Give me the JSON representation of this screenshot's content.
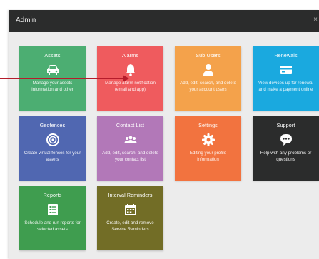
{
  "window": {
    "title": "Admin",
    "close_glyph": "×"
  },
  "tiles": [
    {
      "title": "Assets",
      "icon": "car-icon",
      "description": "Manage your assets information and other",
      "color": "#4cae72"
    },
    {
      "title": "Alarms",
      "icon": "bell-icon",
      "description": "Manage alarm notification (email and app)",
      "color": "#ef5b5e"
    },
    {
      "title": "Sub Users",
      "icon": "user-icon",
      "description": "Add, edit, search, and delete your account users",
      "color": "#f4a24b"
    },
    {
      "title": "Renewals",
      "icon": "card-icon",
      "description": "View devices up for renewal and make a payment online",
      "color": "#1aa9df"
    },
    {
      "title": "Geofences",
      "icon": "target-icon",
      "description": "Create virtual fences for your assets",
      "color": "#5067b1"
    },
    {
      "title": "Contact List",
      "icon": "contacts-icon",
      "description": "Add, edit, search, and delete your contact list",
      "color": "#b278b8"
    },
    {
      "title": "Settings",
      "icon": "gear-icon",
      "description": "Editing your profile information",
      "color": "#f2733f"
    },
    {
      "title": "Support",
      "icon": "chat-icon",
      "description": "Help with any problems or questions",
      "color": "#2b2c2c"
    },
    {
      "title": "Reports",
      "icon": "list-icon",
      "description": "Schedule and run reports for selected assets",
      "color": "#3f9d4f"
    },
    {
      "title": "Interval Reminders",
      "icon": "calendar-icon",
      "description": "Create, edit and remove Service Reminders",
      "color": "#726d26"
    }
  ],
  "annotation": {
    "arrow_color": "#b61c2b"
  }
}
